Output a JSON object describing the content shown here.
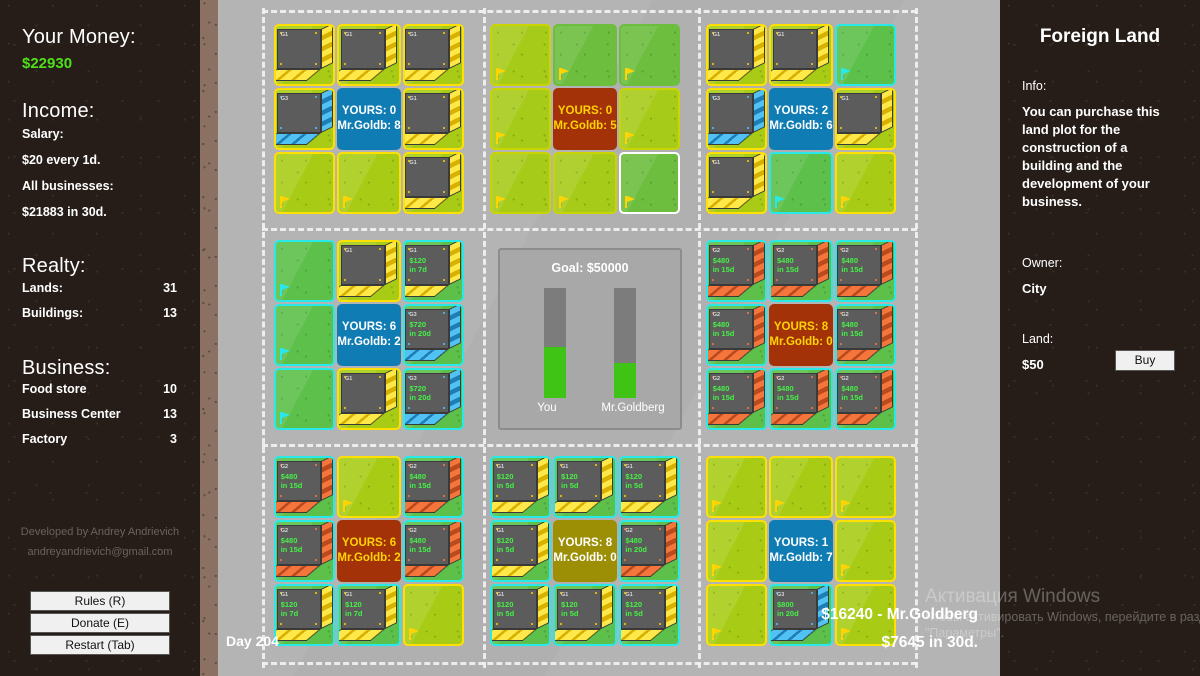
{
  "left_panel": {
    "money_title": "Your Money:",
    "money_value": "$22930",
    "income_title": "Income:",
    "salary_label": "Salary:",
    "salary_value": "$20 every 1d.",
    "businesses_label": "All businesses:",
    "businesses_value": "$21883 in 30d.",
    "realty_title": "Realty:",
    "lands_label": "Lands:",
    "lands_value": "31",
    "buildings_label": "Buildings:",
    "buildings_value": "13",
    "business_title": "Business:",
    "food_store_label": "Food store",
    "food_store_value": "10",
    "business_center_label": "Business Center",
    "business_center_value": "13",
    "factory_label": "Factory",
    "factory_value": "3",
    "credits_line1": "Developed by Andrey Andrievich",
    "credits_line2": "andreyandrievich@gmail.com",
    "rules_button": "Rules (R)",
    "donate_button": "Donate (E)",
    "restart_button": "Restart (Tab)"
  },
  "right_panel": {
    "title": "Foreign Land",
    "info_label": "Info:",
    "info_text": "You can purchase this land plot for the construction of a building and the development of your business.",
    "owner_label": "Owner:",
    "owner_value": "City",
    "land_label": "Land:",
    "land_price": "$50",
    "buy_button": "Buy"
  },
  "overlay": {
    "day": "Day 204",
    "goldberg_money": "$16240 - Mr.Goldberg",
    "goldberg_income": "$7645 in 30d."
  },
  "watermark": {
    "line1": "Активация Windows",
    "line2": "Чтобы активировать Windows, перейдите в раздел \"Параметры\"."
  },
  "chart_data": {
    "type": "bar",
    "title": "Goal: $50000",
    "categories": [
      "You",
      "Mr.Goldberg"
    ],
    "values": [
      22930,
      16240
    ],
    "ylim": [
      0,
      50000
    ],
    "ylabel": "",
    "xlabel": "",
    "grid": false,
    "legend": "none",
    "fill_percent": [
      46,
      32
    ]
  },
  "board": {
    "districts": [
      {
        "name": "district-top-left",
        "center": {
          "style": "blue",
          "yours_label": "YOURS:",
          "yours_value": "0",
          "goldberg_label": "Mr.Goldb:",
          "goldberg_value": "8"
        },
        "tiles": [
          {
            "owner": "gold",
            "building": {
              "tier": "G1",
              "kind": "food",
              "cost": "",
              "time": ""
            }
          },
          {
            "owner": "gold",
            "building": {
              "tier": "G1",
              "kind": "food",
              "cost": "",
              "time": ""
            }
          },
          {
            "owner": "gold",
            "building": {
              "tier": "G1",
              "kind": "food",
              "cost": "",
              "time": ""
            }
          },
          {
            "owner": "gold",
            "building": {
              "tier": "G3",
              "kind": "factory",
              "cost": "",
              "time": ""
            }
          },
          null,
          {
            "owner": "gold",
            "building": {
              "tier": "G1",
              "kind": "food",
              "cost": "",
              "time": ""
            }
          },
          {
            "owner": "gold",
            "building": null
          },
          {
            "owner": "gold",
            "building": null
          },
          {
            "owner": "gold",
            "building": {
              "tier": "G1",
              "kind": "food",
              "cost": "",
              "time": ""
            }
          }
        ]
      },
      {
        "name": "district-top-center",
        "center": {
          "style": "red",
          "yours_label": "YOURS:",
          "yours_value": "0",
          "goldberg_label": "Mr.Goldb:",
          "goldberg_value": "5"
        },
        "tiles": [
          {
            "owner": "city",
            "building": null
          },
          {
            "owner": "none",
            "building": null
          },
          {
            "owner": "none",
            "building": null
          },
          {
            "owner": "city",
            "building": null
          },
          null,
          {
            "owner": "city",
            "building": null
          },
          {
            "owner": "city",
            "building": null
          },
          {
            "owner": "city",
            "building": null
          },
          {
            "owner": "none",
            "building": null,
            "selected": true
          }
        ]
      },
      {
        "name": "district-top-right",
        "center": {
          "style": "blue",
          "yours_label": "YOURS:",
          "yours_value": "2",
          "goldberg_label": "Mr.Goldb:",
          "goldberg_value": "6"
        },
        "tiles": [
          {
            "owner": "gold",
            "building": {
              "tier": "G1",
              "kind": "food",
              "cost": "",
              "time": ""
            }
          },
          {
            "owner": "gold",
            "building": {
              "tier": "G1",
              "kind": "food",
              "cost": "",
              "time": ""
            }
          },
          {
            "owner": "you",
            "building": null
          },
          {
            "owner": "gold",
            "building": {
              "tier": "G3",
              "kind": "factory",
              "cost": "",
              "time": ""
            }
          },
          null,
          {
            "owner": "gold",
            "building": {
              "tier": "G1",
              "kind": "food",
              "cost": "",
              "time": ""
            }
          },
          {
            "owner": "gold",
            "building": {
              "tier": "G1",
              "kind": "food",
              "cost": "",
              "time": ""
            }
          },
          {
            "owner": "you",
            "building": null
          },
          {
            "owner": "gold",
            "building": null
          }
        ]
      },
      {
        "name": "district-mid-left",
        "center": {
          "style": "blue",
          "yours_label": "YOURS:",
          "yours_value": "6",
          "goldberg_label": "Mr.Goldb:",
          "goldberg_value": "2"
        },
        "tiles": [
          {
            "owner": "you",
            "building": null
          },
          {
            "owner": "gold",
            "building": {
              "tier": "G1",
              "kind": "food",
              "cost": "",
              "time": ""
            }
          },
          {
            "owner": "you",
            "building": {
              "tier": "G1",
              "kind": "food",
              "cost": "$120",
              "time": "in 7d"
            }
          },
          {
            "owner": "you",
            "building": null
          },
          null,
          {
            "owner": "you",
            "building": {
              "tier": "G3",
              "kind": "factory",
              "cost": "$720",
              "time": "in 20d"
            }
          },
          {
            "owner": "you",
            "building": null
          },
          {
            "owner": "gold",
            "building": {
              "tier": "G1",
              "kind": "food",
              "cost": "",
              "time": ""
            }
          },
          {
            "owner": "you",
            "building": {
              "tier": "G3",
              "kind": "factory",
              "cost": "$720",
              "time": "in 20d"
            }
          }
        ]
      },
      {
        "name": "district-mid-right",
        "center": {
          "style": "red",
          "yours_label": "YOURS:",
          "yours_value": "8",
          "goldberg_label": "Mr.Goldb:",
          "goldberg_value": "0"
        },
        "tiles": [
          {
            "owner": "you",
            "building": {
              "tier": "G2",
              "kind": "center",
              "cost": "$480",
              "time": "in 15d"
            }
          },
          {
            "owner": "you",
            "building": {
              "tier": "G2",
              "kind": "center",
              "cost": "$480",
              "time": "in 15d"
            }
          },
          {
            "owner": "you",
            "building": {
              "tier": "G2",
              "kind": "center",
              "cost": "$480",
              "time": "in 15d"
            }
          },
          {
            "owner": "you",
            "building": {
              "tier": "G2",
              "kind": "center",
              "cost": "$480",
              "time": "in 15d"
            }
          },
          null,
          {
            "owner": "you",
            "building": {
              "tier": "G2",
              "kind": "center",
              "cost": "$480",
              "time": "in 15d"
            }
          },
          {
            "owner": "you",
            "building": {
              "tier": "G2",
              "kind": "center",
              "cost": "$480",
              "time": "in 15d"
            }
          },
          {
            "owner": "you",
            "building": {
              "tier": "G2",
              "kind": "center",
              "cost": "$480",
              "time": "in 15d"
            }
          },
          {
            "owner": "you",
            "building": {
              "tier": "G2",
              "kind": "center",
              "cost": "$480",
              "time": "in 15d"
            }
          }
        ]
      },
      {
        "name": "district-bottom-left",
        "center": {
          "style": "red",
          "yours_label": "YOURS:",
          "yours_value": "6",
          "goldberg_label": "Mr.Goldb:",
          "goldberg_value": "2"
        },
        "tiles": [
          {
            "owner": "you",
            "building": {
              "tier": "G2",
              "kind": "center",
              "cost": "$480",
              "time": "in 15d"
            }
          },
          {
            "owner": "gold",
            "building": null
          },
          {
            "owner": "you",
            "building": {
              "tier": "G2",
              "kind": "center",
              "cost": "$480",
              "time": "in 15d"
            }
          },
          {
            "owner": "you",
            "building": {
              "tier": "G2",
              "kind": "center",
              "cost": "$480",
              "time": "in 15d"
            }
          },
          null,
          {
            "owner": "you",
            "building": {
              "tier": "G2",
              "kind": "center",
              "cost": "$480",
              "time": "in 15d"
            }
          },
          {
            "owner": "you",
            "building": {
              "tier": "G1",
              "kind": "food",
              "cost": "$120",
              "time": "in 7d"
            }
          },
          {
            "owner": "you",
            "building": {
              "tier": "G1",
              "kind": "food",
              "cost": "$120",
              "time": "in 7d"
            }
          },
          {
            "owner": "gold",
            "building": null
          }
        ]
      },
      {
        "name": "district-bottom-center",
        "center": {
          "style": "olive",
          "yours_label": "YOURS:",
          "yours_value": "8",
          "goldberg_label": "Mr.Goldb:",
          "goldberg_value": "0"
        },
        "tiles": [
          {
            "owner": "you",
            "building": {
              "tier": "G1",
              "kind": "food",
              "cost": "$120",
              "time": "in 5d"
            }
          },
          {
            "owner": "you",
            "building": {
              "tier": "G1",
              "kind": "food",
              "cost": "$120",
              "time": "in 5d"
            }
          },
          {
            "owner": "you",
            "building": {
              "tier": "G1",
              "kind": "food",
              "cost": "$120",
              "time": "in 5d"
            }
          },
          {
            "owner": "you",
            "building": {
              "tier": "G1",
              "kind": "food",
              "cost": "$120",
              "time": "in 5d"
            }
          },
          null,
          {
            "owner": "you",
            "building": {
              "tier": "G2",
              "kind": "center",
              "cost": "$480",
              "time": "in 20d"
            }
          },
          {
            "owner": "you",
            "building": {
              "tier": "G1",
              "kind": "food",
              "cost": "$120",
              "time": "in 5d"
            }
          },
          {
            "owner": "you",
            "building": {
              "tier": "G1",
              "kind": "food",
              "cost": "$120",
              "time": "in 5d"
            }
          },
          {
            "owner": "you",
            "building": {
              "tier": "G1",
              "kind": "food",
              "cost": "$120",
              "time": "in 5d"
            }
          }
        ]
      },
      {
        "name": "district-bottom-right",
        "center": {
          "style": "blue",
          "yours_label": "YOURS:",
          "yours_value": "1",
          "goldberg_label": "Mr.Goldb:",
          "goldberg_value": "7"
        },
        "tiles": [
          {
            "owner": "gold",
            "building": null
          },
          {
            "owner": "gold",
            "building": null
          },
          {
            "owner": "gold",
            "building": null
          },
          {
            "owner": "gold",
            "building": null
          },
          null,
          {
            "owner": "gold",
            "building": null
          },
          {
            "owner": "gold",
            "building": null
          },
          {
            "owner": "you",
            "building": {
              "tier": "G3",
              "kind": "factory",
              "cost": "$800",
              "time": "in 20d"
            }
          },
          {
            "owner": "gold",
            "building": null
          }
        ]
      }
    ]
  }
}
